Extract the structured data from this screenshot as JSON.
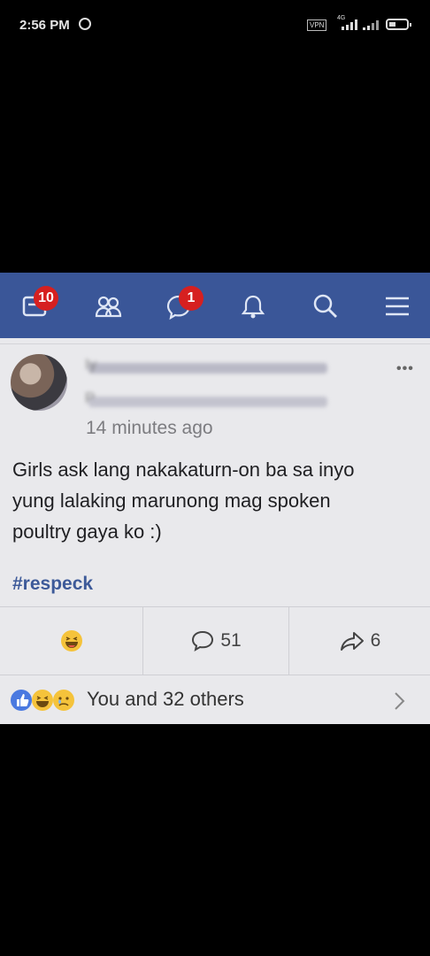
{
  "status_bar": {
    "time": "2:56 PM",
    "vpn_label": "VPN",
    "network_label": "4G",
    "icons": [
      "alarm-icon",
      "vpn-icon",
      "signal-icon",
      "signal-icon",
      "battery-icon"
    ]
  },
  "nav": {
    "notifications_badge": "10",
    "messages_badge": "1",
    "icons": [
      "newsfeed-icon",
      "friends-icon",
      "messenger-icon",
      "bell-icon",
      "search-icon",
      "menu-icon"
    ],
    "colors": {
      "bar": "#3a5698",
      "badge": "#d62020"
    }
  },
  "post": {
    "author_fragment": "Iy",
    "subtitle_fragment": "P",
    "timestamp": "14 minutes ago",
    "text_lines": [
      "Girls ask lang nakakaturn-on ba sa inyo",
      "yung lalaking marunong mag spoken",
      "poultry gaya ko :)"
    ],
    "hashtag": "#respeck"
  },
  "actions": {
    "comment_count": "51",
    "share_count": "6"
  },
  "reactions": {
    "summary": "You and 32 others",
    "icons": [
      "like-icon",
      "haha-icon",
      "sad-icon"
    ]
  }
}
